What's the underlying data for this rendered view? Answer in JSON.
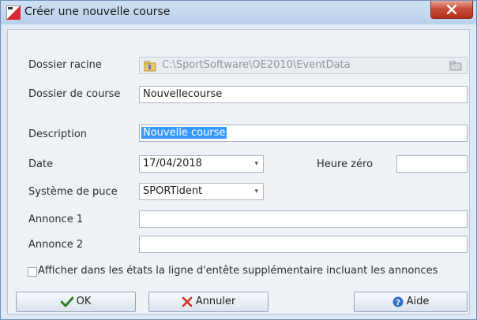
{
  "window": {
    "title": "Créer une nouvelle course"
  },
  "form": {
    "dossier_racine": {
      "label": "Dossier racine",
      "value": "C:\\SportSoftware\\OE2010\\EventData"
    },
    "dossier_course": {
      "label": "Dossier de course",
      "value": "Nouvellecourse"
    },
    "description": {
      "label": "Description",
      "value": "Nouvelle course"
    },
    "date": {
      "label": "Date",
      "value": "17/04/2018"
    },
    "heure_zero": {
      "label": "Heure zéro",
      "value": ""
    },
    "systeme_puce": {
      "label": "Système de puce",
      "value": "SPORTident"
    },
    "annonce1": {
      "label": "Annonce 1",
      "value": ""
    },
    "annonce2": {
      "label": "Annonce 2",
      "value": ""
    },
    "checkbox_label": "Afficher dans les états la ligne d'entête supplémentaire incluant les annonces"
  },
  "buttons": {
    "ok": "OK",
    "cancel": "Annuler",
    "help": "Aide"
  },
  "colors": {
    "ok_icon": "#2e7d1f",
    "cancel_icon": "#d0321c",
    "help_icon": "#2f6fc4",
    "close_button": "#c9503a"
  }
}
